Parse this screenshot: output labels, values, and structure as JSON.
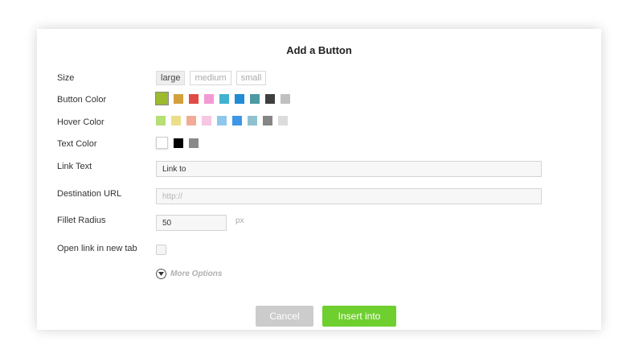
{
  "dialog": {
    "title": "Add a Button"
  },
  "size": {
    "label": "Size",
    "options": [
      "large",
      "medium",
      "small"
    ],
    "selected": "large"
  },
  "button_color": {
    "label": "Button Color",
    "swatches": [
      "#9dbb2e",
      "#d4a03c",
      "#e04b45",
      "#f29ad3",
      "#41b3d0",
      "#1f8cd5",
      "#4d9aa3",
      "#3f3f3f",
      "#c0c0c0"
    ],
    "selected_index": 0
  },
  "hover_color": {
    "label": "Hover Color",
    "swatches": [
      "#b6df75",
      "#ecdf8a",
      "#f2ac96",
      "#f6c6e2",
      "#8fc8ec",
      "#3d96e6",
      "#8fc2cf",
      "#858585",
      "#dcdcdc"
    ]
  },
  "text_color": {
    "label": "Text Color",
    "swatches": [
      "#ffffff",
      "#000000",
      "#8a8a8a"
    ],
    "selected_index": 0
  },
  "link_text": {
    "label": "Link Text",
    "value": "Link to"
  },
  "destination_url": {
    "label": "Destination URL",
    "placeholder": "http://"
  },
  "fillet_radius": {
    "label": "Fillet Radius",
    "value": "50",
    "unit": "px"
  },
  "open_new_tab": {
    "label": "Open link in new tab",
    "checked": false
  },
  "more_options": {
    "label": "More Options",
    "icon": "chevron-down-circle-icon"
  },
  "footer": {
    "cancel_label": "Cancel",
    "insert_label": "Insert into",
    "cancel_color": "#cccccc",
    "insert_color": "#6fcf2f"
  }
}
